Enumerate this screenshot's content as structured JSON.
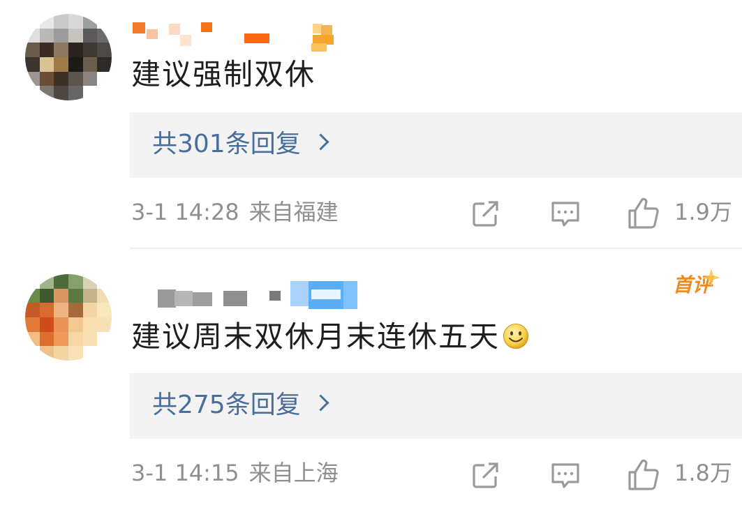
{
  "comments": [
    {
      "text": "建议强制双休",
      "replies_label": "共301条回复",
      "date": "3-1 14:28",
      "location": "来自福建",
      "likes": "1.9万",
      "first_badge": false
    },
    {
      "text": "建议周末双休月末连休五天",
      "emoji": "smile-emoji",
      "replies_label": "共275条回复",
      "date": "3-1 14:15",
      "location": "来自上海",
      "likes": "1.8万",
      "first_badge": true,
      "badge_label": "首评"
    }
  ],
  "icons": {
    "share": "share-icon",
    "comment": "comment-icon",
    "like": "thumbs-up-icon"
  },
  "colors": {
    "reply_link": "#4a6e9a",
    "meta_text": "#8f8f8f",
    "reply_bg": "#f3f3f3",
    "badge": "#f08a1c"
  }
}
